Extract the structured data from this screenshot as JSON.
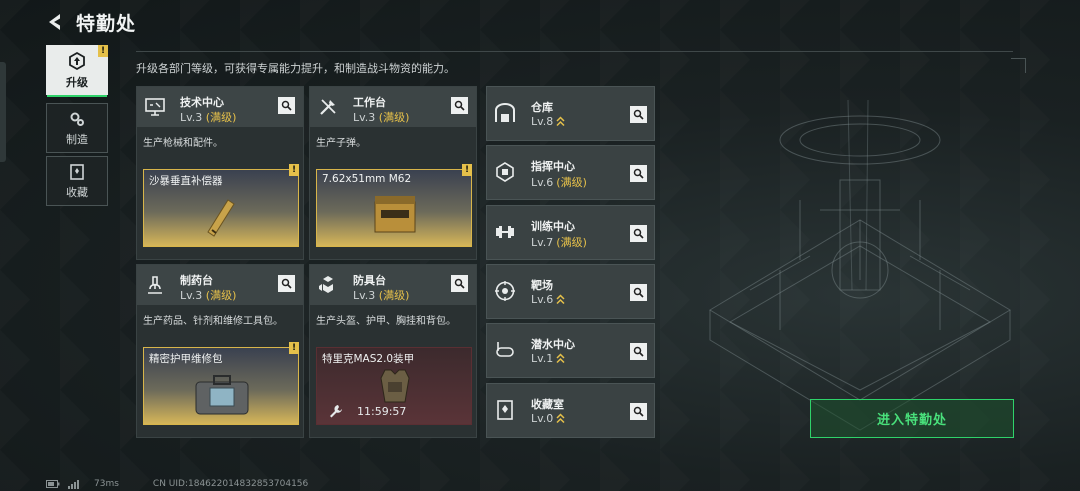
{
  "header": {
    "title": "特勤处"
  },
  "sidebar": {
    "tabs": [
      {
        "label": "升级",
        "active": true,
        "alert": "!"
      },
      {
        "label": "制造",
        "active": false
      },
      {
        "label": "收藏",
        "active": false
      }
    ]
  },
  "subtitle": "升级各部门等级，可获得专属能力提升，和制造战斗物资的能力。",
  "departments": [
    {
      "name": "技术中心",
      "level": "Lv.3",
      "max": "(满级)",
      "desc": "生产枪械和配件。",
      "product": "沙暴垂直补偿器",
      "badge": "!"
    },
    {
      "name": "工作台",
      "level": "Lv.3",
      "max": "(满级)",
      "desc": "生产子弹。",
      "product": "7.62x51mm M62",
      "badge": "!"
    },
    {
      "name": "制药台",
      "level": "Lv.3",
      "max": "(满级)",
      "desc": "生产药品、针剂和维修工具包。",
      "product": "精密护甲维修包",
      "badge": "!"
    },
    {
      "name": "防具台",
      "level": "Lv.3",
      "max": "(满级)",
      "desc": "生产头盔、护甲、胸挂和背包。",
      "product": "特里克MAS2.0装甲",
      "timer": "11:59:57"
    }
  ],
  "facilities": [
    {
      "name": "仓库",
      "level": "Lv.8",
      "max": "",
      "icon": "warehouse-icon",
      "upgradable": true
    },
    {
      "name": "指挥中心",
      "level": "Lv.6",
      "max": "(满级)",
      "icon": "chip-icon",
      "upgradable": false
    },
    {
      "name": "训练中心",
      "level": "Lv.7",
      "max": "(满级)",
      "icon": "dumbbell-icon",
      "upgradable": false
    },
    {
      "name": "靶场",
      "level": "Lv.6",
      "max": "",
      "icon": "target-icon",
      "upgradable": true
    },
    {
      "name": "潜水中心",
      "level": "Lv.1",
      "max": "",
      "icon": "diving-mask-icon",
      "upgradable": true
    },
    {
      "name": "收藏室",
      "level": "Lv.0",
      "max": "",
      "icon": "collection-icon",
      "upgradable": true
    }
  ],
  "enter_button": "进入特勤处",
  "footer": {
    "ping": "73ms",
    "uid": "CN UID:1846220148328537041​56"
  },
  "colors": {
    "accent_green": "#2fd26a",
    "max_gold": "#e5c04a",
    "alert_yellow": "#e5c04a"
  }
}
